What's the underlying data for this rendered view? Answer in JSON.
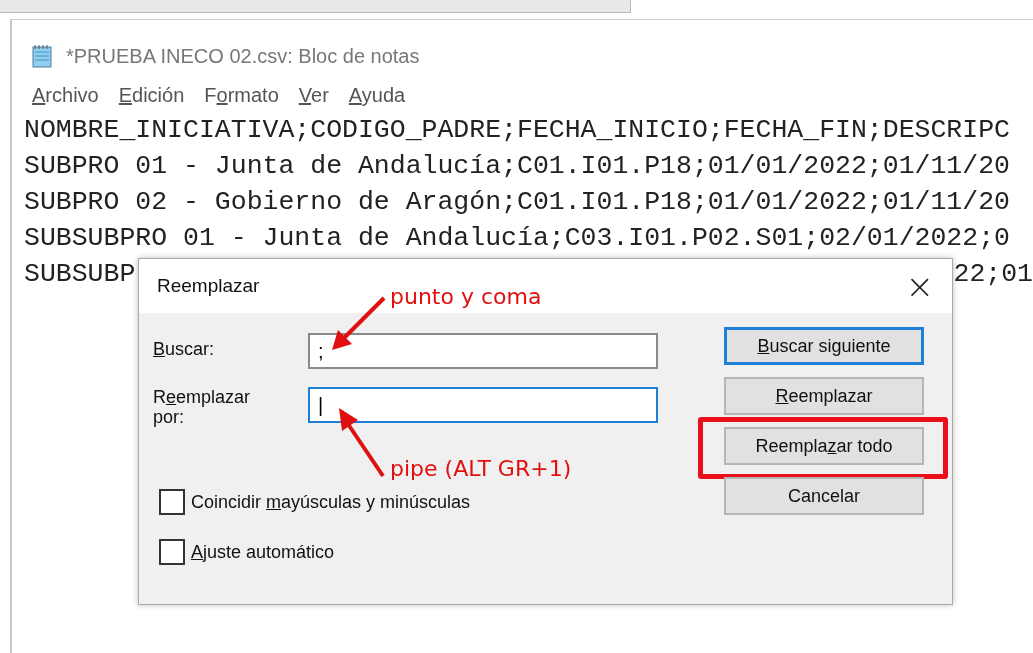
{
  "window": {
    "title": "*PRUEBA INECO 02.csv: Bloc de notas"
  },
  "menu": [
    {
      "label": [
        {
          "text": "A",
          "underlined": true
        },
        {
          "text": "rchivo",
          "underlined": false
        }
      ]
    },
    {
      "label": [
        {
          "text": "E",
          "underlined": true
        },
        {
          "text": "dición",
          "underlined": false
        }
      ]
    },
    {
      "label": [
        {
          "text": "F",
          "underlined": false
        },
        {
          "text": "o",
          "underlined": true
        },
        {
          "text": "rmato",
          "underlined": false
        }
      ]
    },
    {
      "label": [
        {
          "text": "V",
          "underlined": true
        },
        {
          "text": "er",
          "underlined": false
        }
      ]
    },
    {
      "label": [
        {
          "text": "A",
          "underlined": true
        },
        {
          "text": "yuda",
          "underlined": false
        }
      ]
    }
  ],
  "editor": {
    "lines": [
      {
        "left": "NOMBRE_INICIATIVA;CODIGO_PADRE;FECHA_INICIO;FECHA_FIN;DESCRIPC"
      },
      {
        "left": "SUBPRO 01 - Junta de Andalucía;C01.I01.P18;01/01/2022;01/11/20"
      },
      {
        "left": "SUBPRO 02 - Gobierno de Aragón;C01.I01.P18;01/01/2022;01/11/20"
      },
      {
        "left": "SUBSUBPRO 01 - Junta de Andalucía;C03.I01.P02.S01;02/01/2022;0"
      },
      {
        "left": "SUBSUBP",
        "right": "22;01"
      }
    ]
  },
  "dialog": {
    "title": "Reemplazar",
    "close": "×",
    "fields": [
      {
        "label": [
          {
            "text": "B",
            "underlined": true
          },
          {
            "text": "uscar:",
            "underlined": false
          }
        ],
        "value": ";",
        "focused": false
      },
      {
        "label": [
          {
            "text": "R",
            "underlined": false
          },
          {
            "text": "e",
            "underlined": true
          },
          {
            "text": "emplazar por:",
            "underlined": false
          }
        ],
        "value": "|",
        "focused": true
      }
    ],
    "checkboxes": [
      {
        "label": [
          {
            "text": "Coincidir ",
            "underlined": false
          },
          {
            "text": "m",
            "underlined": true
          },
          {
            "text": "ayúsculas y minúsculas",
            "underlined": false
          }
        ],
        "checked": false
      },
      {
        "label": [
          {
            "text": "A",
            "underlined": true
          },
          {
            "text": "juste automático",
            "underlined": false
          }
        ],
        "checked": false
      }
    ],
    "buttons": [
      {
        "label": [
          {
            "text": "B",
            "underlined": true
          },
          {
            "text": "uscar siguiente",
            "underlined": false
          }
        ],
        "default": true,
        "highlighted": false
      },
      {
        "label": [
          {
            "text": "R",
            "underlined": true
          },
          {
            "text": "eemplazar",
            "underlined": false
          }
        ],
        "default": false,
        "highlighted": false
      },
      {
        "label": [
          {
            "text": "Reempla",
            "underlined": false
          },
          {
            "text": "z",
            "underlined": true
          },
          {
            "text": "ar todo",
            "underlined": false
          }
        ],
        "default": false,
        "highlighted": true
      },
      {
        "label": [
          {
            "text": "Cancelar",
            "underlined": false
          }
        ],
        "default": false,
        "highlighted": false
      }
    ]
  },
  "annotations": [
    {
      "kind": "callout-up",
      "text": "punto y coma"
    },
    {
      "kind": "callout-down",
      "text": "pipe (ALT GR+1)"
    }
  ]
}
